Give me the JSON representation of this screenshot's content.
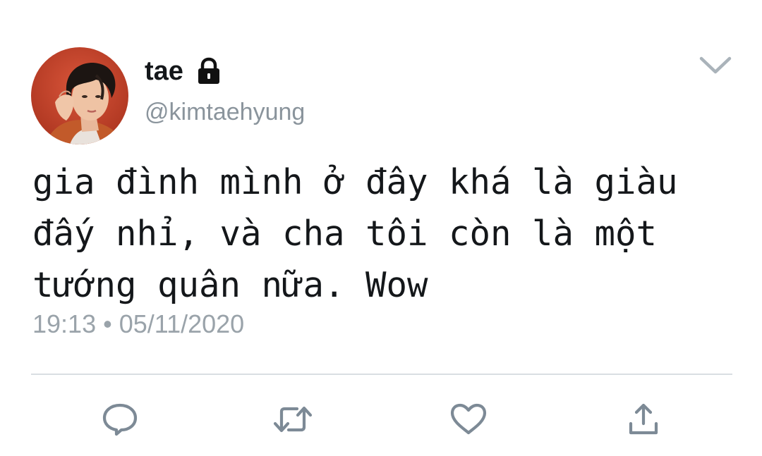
{
  "tweet": {
    "display_name": "tae",
    "handle": "@kimtaehyung",
    "text": "gia đình mình ở đây khá là giàu\nđấy nhỉ, và cha tôi còn là một\ntướng quân nữa. Wow",
    "timestamp": "19:13 • 05/11/2020",
    "protected": true
  },
  "icons": {
    "lock": "lock-icon",
    "menu": "chevron-down-icon",
    "reply": "reply-icon",
    "retweet": "retweet-icon",
    "like": "heart-icon",
    "share": "share-icon"
  },
  "colors": {
    "text": "#14171a",
    "secondary": "#8a949c",
    "icon": "#7d8a96",
    "divider": "#d9dee2",
    "avatar_bg": "#c8432a"
  }
}
